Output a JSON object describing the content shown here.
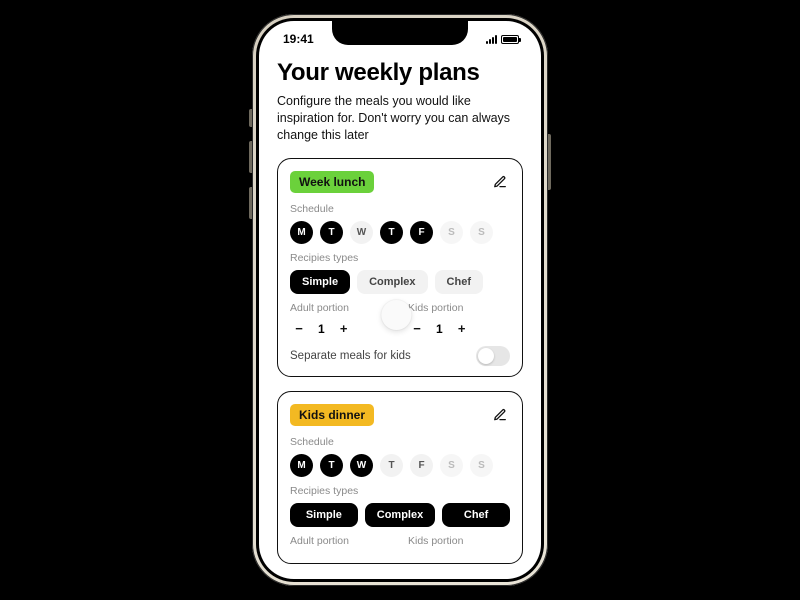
{
  "status": {
    "time": "19:41"
  },
  "page": {
    "title": "Your weekly plans",
    "subtitle": "Configure the meals you would like inspiration for. Don't worry you can always change this later"
  },
  "labels": {
    "schedule": "Schedule",
    "recipe_types": "Recipies types",
    "adult_portion": "Adult portion",
    "kids_portion": "Kids portion",
    "separate_meals": "Separate meals for kids"
  },
  "days": [
    "M",
    "T",
    "W",
    "T",
    "F",
    "S",
    "S"
  ],
  "recipes": [
    "Simple",
    "Complex",
    "Chef"
  ],
  "plans": [
    {
      "name": "Week lunch",
      "color": "green",
      "day_states": [
        "on",
        "on",
        "off",
        "on",
        "on",
        "faint",
        "faint"
      ],
      "recipe_states": [
        "on",
        "off",
        "off"
      ],
      "adult_value": "1",
      "kids_value": "1",
      "separate_on": false
    },
    {
      "name": "Kids dinner",
      "color": "yellow",
      "day_states": [
        "on",
        "on",
        "on",
        "off",
        "off",
        "faint",
        "faint"
      ],
      "recipe_states": [
        "on",
        "on",
        "on"
      ],
      "adult_value": "",
      "kids_value": "",
      "separate_on": false
    }
  ]
}
